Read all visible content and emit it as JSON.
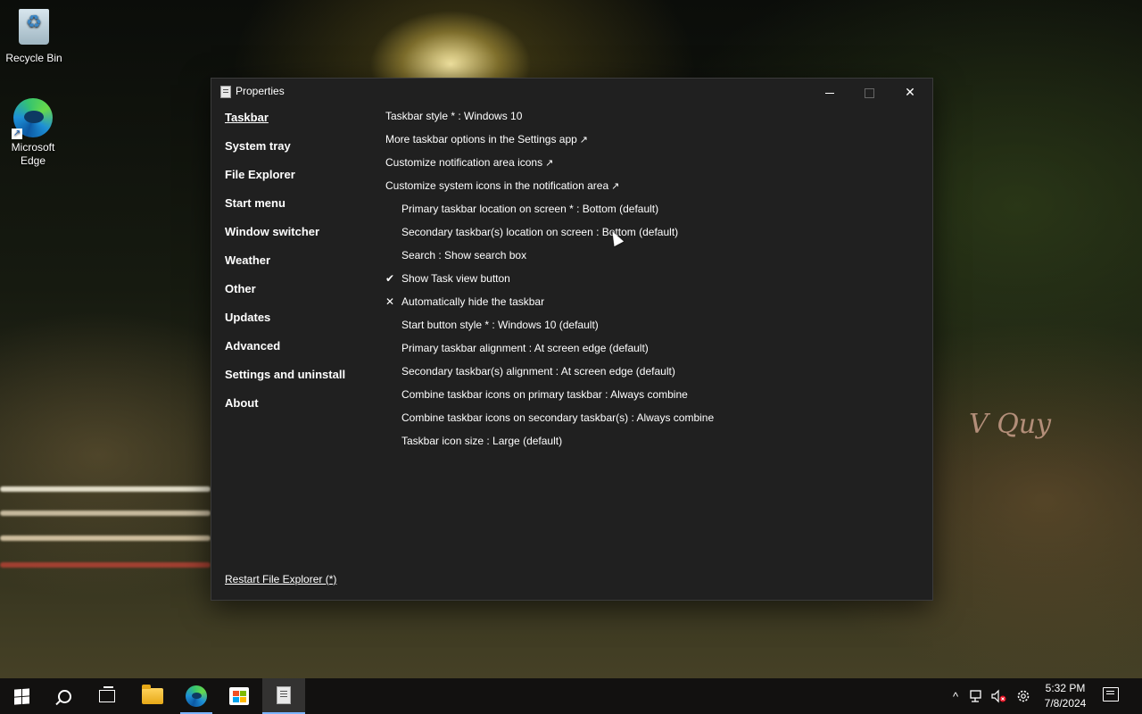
{
  "desktop": {
    "icons": [
      {
        "label": "Recycle Bin"
      },
      {
        "label": "Microsoft Edge"
      }
    ],
    "wallpaper_sign": "V Quy"
  },
  "window": {
    "title": "Properties",
    "nav": [
      {
        "label": "Taskbar",
        "active": true
      },
      {
        "label": "System tray"
      },
      {
        "label": "File Explorer"
      },
      {
        "label": "Start menu"
      },
      {
        "label": "Window switcher"
      },
      {
        "label": "Weather"
      },
      {
        "label": "Other"
      },
      {
        "label": "Updates"
      },
      {
        "label": "Advanced"
      },
      {
        "label": "Settings and uninstall"
      },
      {
        "label": "About"
      }
    ],
    "restart_label": "Restart File Explorer (*)",
    "options": [
      {
        "label": "Taskbar style * : Windows 10",
        "indent": false,
        "mark": ""
      },
      {
        "label": "More taskbar options in the Settings app",
        "indent": false,
        "mark": "",
        "external": "↗"
      },
      {
        "label": "Customize notification area icons",
        "indent": false,
        "mark": "",
        "external": "↗"
      },
      {
        "label": "Customize system icons in the notification area",
        "indent": false,
        "mark": "",
        "external": "↗"
      },
      {
        "label": "Primary taskbar location on screen * : Bottom (default)",
        "indent": true,
        "mark": ""
      },
      {
        "label": "Secondary taskbar(s) location on screen : Bottom (default)",
        "indent": true,
        "mark": ""
      },
      {
        "label": "Search : Show search box",
        "indent": true,
        "mark": ""
      },
      {
        "label": "Show Task view button",
        "indent": true,
        "mark": "✔"
      },
      {
        "label": "Automatically hide the taskbar",
        "indent": true,
        "mark": "✕"
      },
      {
        "label": "Start button style * : Windows 10 (default)",
        "indent": true,
        "mark": ""
      },
      {
        "label": "Primary taskbar alignment : At screen edge (default)",
        "indent": true,
        "mark": ""
      },
      {
        "label": "Secondary taskbar(s) alignment : At screen edge (default)",
        "indent": true,
        "mark": ""
      },
      {
        "label": "Combine taskbar icons on primary taskbar : Always combine",
        "indent": true,
        "mark": ""
      },
      {
        "label": "Combine taskbar icons on secondary taskbar(s) : Always combine",
        "indent": true,
        "mark": ""
      },
      {
        "label": "Taskbar icon size : Large (default)",
        "indent": true,
        "mark": ""
      }
    ]
  },
  "taskbar": {
    "apps": [
      "start-button",
      "search-button",
      "task-view-button",
      "file-explorer",
      "microsoft-edge",
      "microsoft-store",
      "properties-app"
    ],
    "tray": {
      "chevron": "^",
      "time": "5:32 PM",
      "date": "7/8/2024"
    }
  }
}
